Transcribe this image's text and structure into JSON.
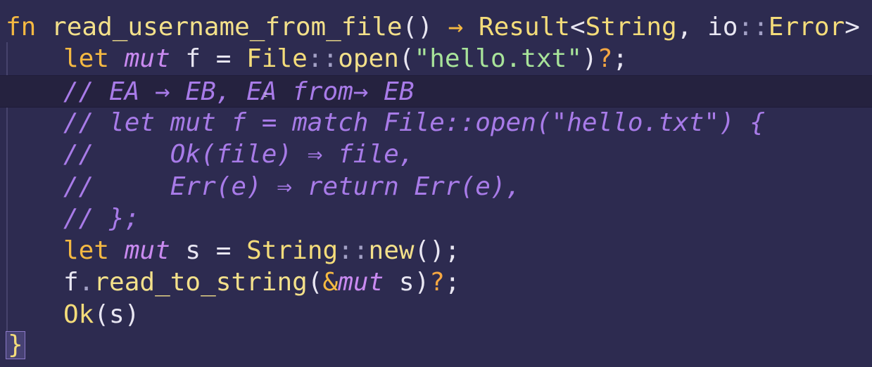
{
  "lines": [
    {
      "segments": [
        {
          "t": "fn",
          "c": "kw"
        },
        {
          "t": " ",
          "c": "pun"
        },
        {
          "t": "read_username_from_file",
          "c": "fn"
        },
        {
          "t": "()",
          "c": "pun"
        },
        {
          "t": " → ",
          "c": "arrow"
        },
        {
          "t": "Result",
          "c": "ty"
        },
        {
          "t": "<",
          "c": "pun"
        },
        {
          "t": "String",
          "c": "ty"
        },
        {
          "t": ", ",
          "c": "pun"
        },
        {
          "t": "io",
          "c": "pun"
        },
        {
          "t": "::",
          "c": "dim"
        },
        {
          "t": "Error",
          "c": "ty"
        },
        {
          "t": "> ",
          "c": "pun"
        }
      ],
      "brace": "{"
    },
    {
      "indent": 1,
      "segments": [
        {
          "t": "let",
          "c": "kw"
        },
        {
          "t": " ",
          "c": "pun"
        },
        {
          "t": "mut",
          "c": "it"
        },
        {
          "t": " f = ",
          "c": "pun"
        },
        {
          "t": "File",
          "c": "ty"
        },
        {
          "t": "::",
          "c": "dim"
        },
        {
          "t": "open",
          "c": "fn"
        },
        {
          "t": "(",
          "c": "pun"
        },
        {
          "t": "\"hello.txt\"",
          "c": "str"
        },
        {
          "t": ")",
          "c": "pun"
        },
        {
          "t": "?",
          "c": "err"
        },
        {
          "t": ";",
          "c": "pun"
        }
      ]
    },
    {
      "indent": 1,
      "current": true,
      "segments": [
        {
          "t": "// EA → EB, EA from→ EB",
          "c": "cm"
        }
      ]
    },
    {
      "indent": 1,
      "segments": [
        {
          "t": "// let mut f = match File::open(\"hello.txt\") {",
          "c": "cm"
        }
      ]
    },
    {
      "indent": 1,
      "segments": [
        {
          "t": "//     Ok(file) ⇒ file,",
          "c": "cm"
        }
      ]
    },
    {
      "indent": 1,
      "segments": [
        {
          "t": "//     Err(e) ⇒ return Err(e),",
          "c": "cm"
        }
      ]
    },
    {
      "indent": 1,
      "segments": [
        {
          "t": "// };",
          "c": "cm"
        }
      ]
    },
    {
      "indent": 1,
      "segments": [
        {
          "t": "let",
          "c": "kw"
        },
        {
          "t": " ",
          "c": "pun"
        },
        {
          "t": "mut",
          "c": "it"
        },
        {
          "t": " s = ",
          "c": "pun"
        },
        {
          "t": "String",
          "c": "ty"
        },
        {
          "t": "::",
          "c": "dim"
        },
        {
          "t": "new",
          "c": "fn"
        },
        {
          "t": "();",
          "c": "pun"
        }
      ]
    },
    {
      "indent": 1,
      "segments": [
        {
          "t": "f",
          "c": "pun"
        },
        {
          "t": ".",
          "c": "dim"
        },
        {
          "t": "read_to_string",
          "c": "fn"
        },
        {
          "t": "(",
          "c": "pun"
        },
        {
          "t": "&",
          "c": "kw"
        },
        {
          "t": "mut",
          "c": "it"
        },
        {
          "t": " s)",
          "c": "pun"
        },
        {
          "t": "?",
          "c": "err"
        },
        {
          "t": ";",
          "c": "pun"
        }
      ]
    },
    {
      "indent": 1,
      "segments": [
        {
          "t": "Ok",
          "c": "ty"
        },
        {
          "t": "(s)",
          "c": "pun"
        }
      ]
    },
    {
      "segments": [],
      "brace": "}"
    }
  ],
  "colors": {
    "background": "#2d2b50",
    "current_line": "#25223f",
    "keyword": "#f5b942",
    "comment": "#a87be8",
    "string": "#a8e39a",
    "type": "#f4dc7a"
  }
}
